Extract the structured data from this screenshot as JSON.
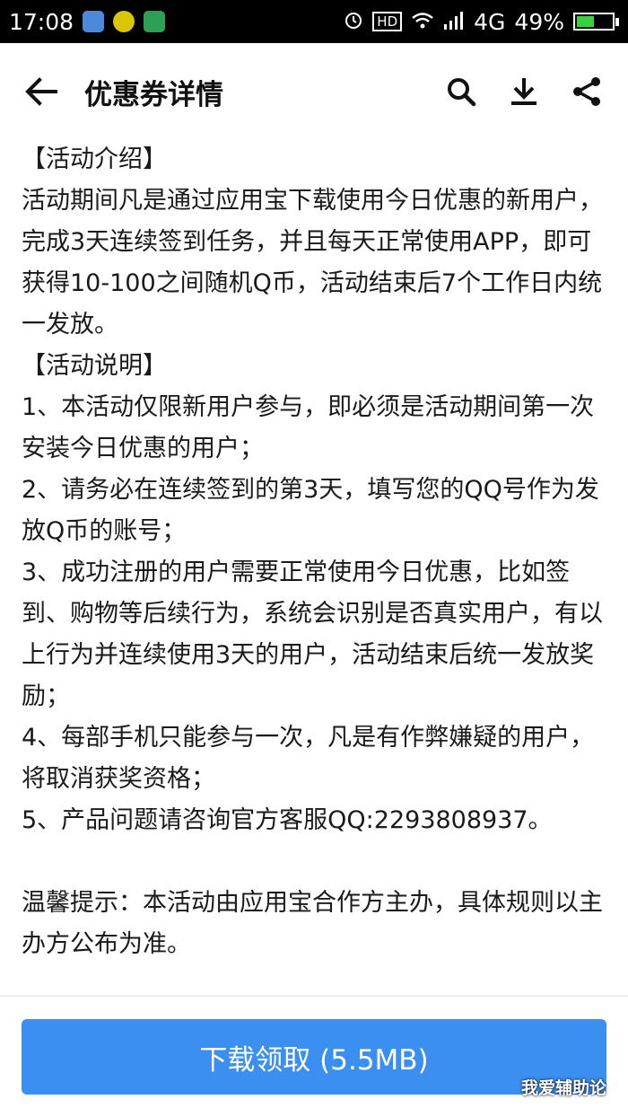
{
  "status_bar": {
    "time": "17:08",
    "hd": "HD",
    "network": "4G",
    "battery": "49%",
    "battery_level": 0.49,
    "notifications": [
      "wechat-icon",
      "plus-badge-icon",
      "scan-icon"
    ]
  },
  "app_bar": {
    "title": "优惠券详情",
    "icons": [
      "back-arrow-icon",
      "search-icon",
      "download-icon",
      "share-icon"
    ]
  },
  "content": {
    "lines": [
      "【活动介绍】",
      "活动期间凡是通过应用宝下载使用今日优惠的新用户，",
      "完成3天连续签到任务，并且每天正常使用APP，即可",
      "获得10-100之间随机Q币，活动结束后7个工作日内统",
      "一发放。",
      "【活动说明】",
      "1、本活动仅限新用户参与，即必须是活动期间第一次",
      "安装今日优惠的用户；",
      "2、请务必在连续签到的第3天，填写您的QQ号作为发",
      "放Q币的账号；",
      "3、成功注册的用户需要正常使用今日优惠，比如签",
      "到、购物等后续行为，系统会识别是否真实用户，有以",
      "上行为并连续使用3天的用户，活动结束后统一发放奖",
      "励；",
      "4、每部手机只能参与一次，凡是有作弊嫌疑的用户，",
      "将取消获奖资格；",
      "5、产品问题请咨询官方客服QQ:2293808937。",
      "",
      "温馨提示：本活动由应用宝合作方主办，具体规则以主",
      "办方公布为准。"
    ]
  },
  "download_button": {
    "label": "下载领取 (5.5MB)",
    "color": "#3b8ff0"
  },
  "watermark": "我爱辅助论"
}
